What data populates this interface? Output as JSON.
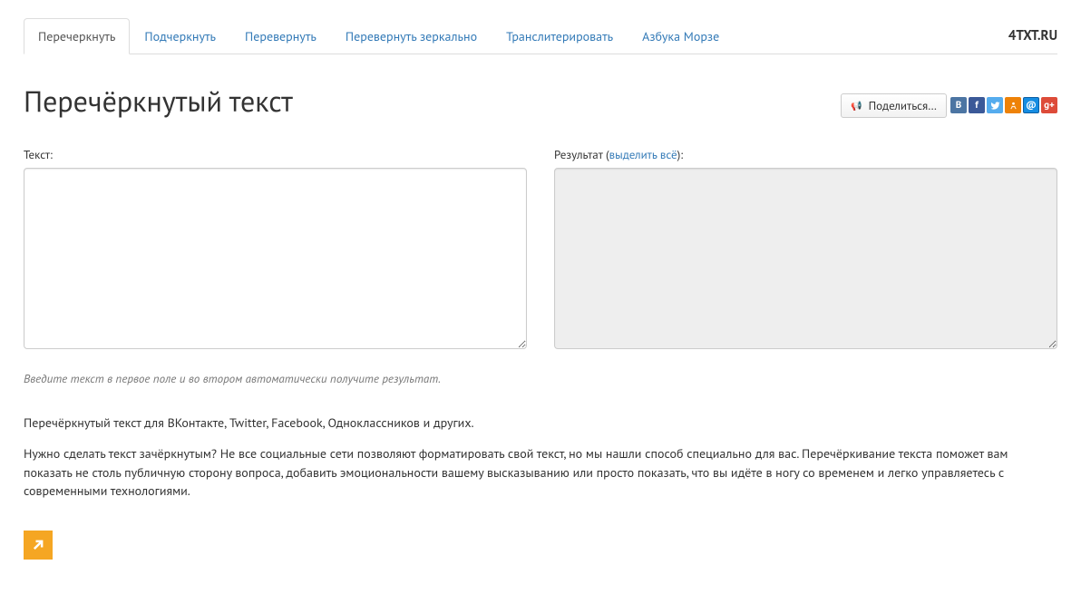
{
  "brand": "4TXT.RU",
  "tabs": [
    {
      "label": "Перечеркнуть",
      "active": true
    },
    {
      "label": "Подчеркнуть",
      "active": false
    },
    {
      "label": "Перевернуть",
      "active": false
    },
    {
      "label": "Перевернуть зеркально",
      "active": false
    },
    {
      "label": "Транслитерировать",
      "active": false
    },
    {
      "label": "Азбука Морзе",
      "active": false
    }
  ],
  "title": "Перечёркнутый текст",
  "share": {
    "button_label": "Поделиться…"
  },
  "labels": {
    "input": "Текст:",
    "result_prefix": "Результат (",
    "select_all": "выделить всё",
    "result_suffix": "):"
  },
  "fields": {
    "input_value": "",
    "result_value": ""
  },
  "hint": "Введите текст в первое поле и во втором автоматически получите результат.",
  "description": {
    "p1": "Перечёркнутый текст для ВКонтакте, Twitter, Facebook, Одноклассников и других.",
    "p2": "Нужно сделать текст зачёркнутым? Не все социальные сети позволяют форматировать свой текст, но мы нашли способ специально для вас. Перечёркивание текста поможет вам показать не столь публичную сторону вопроса, добавить эмоциональности вашему высказыванию или просто показать, что вы идёте в ногу со временем и легко управляетесь с современными технологиями."
  }
}
